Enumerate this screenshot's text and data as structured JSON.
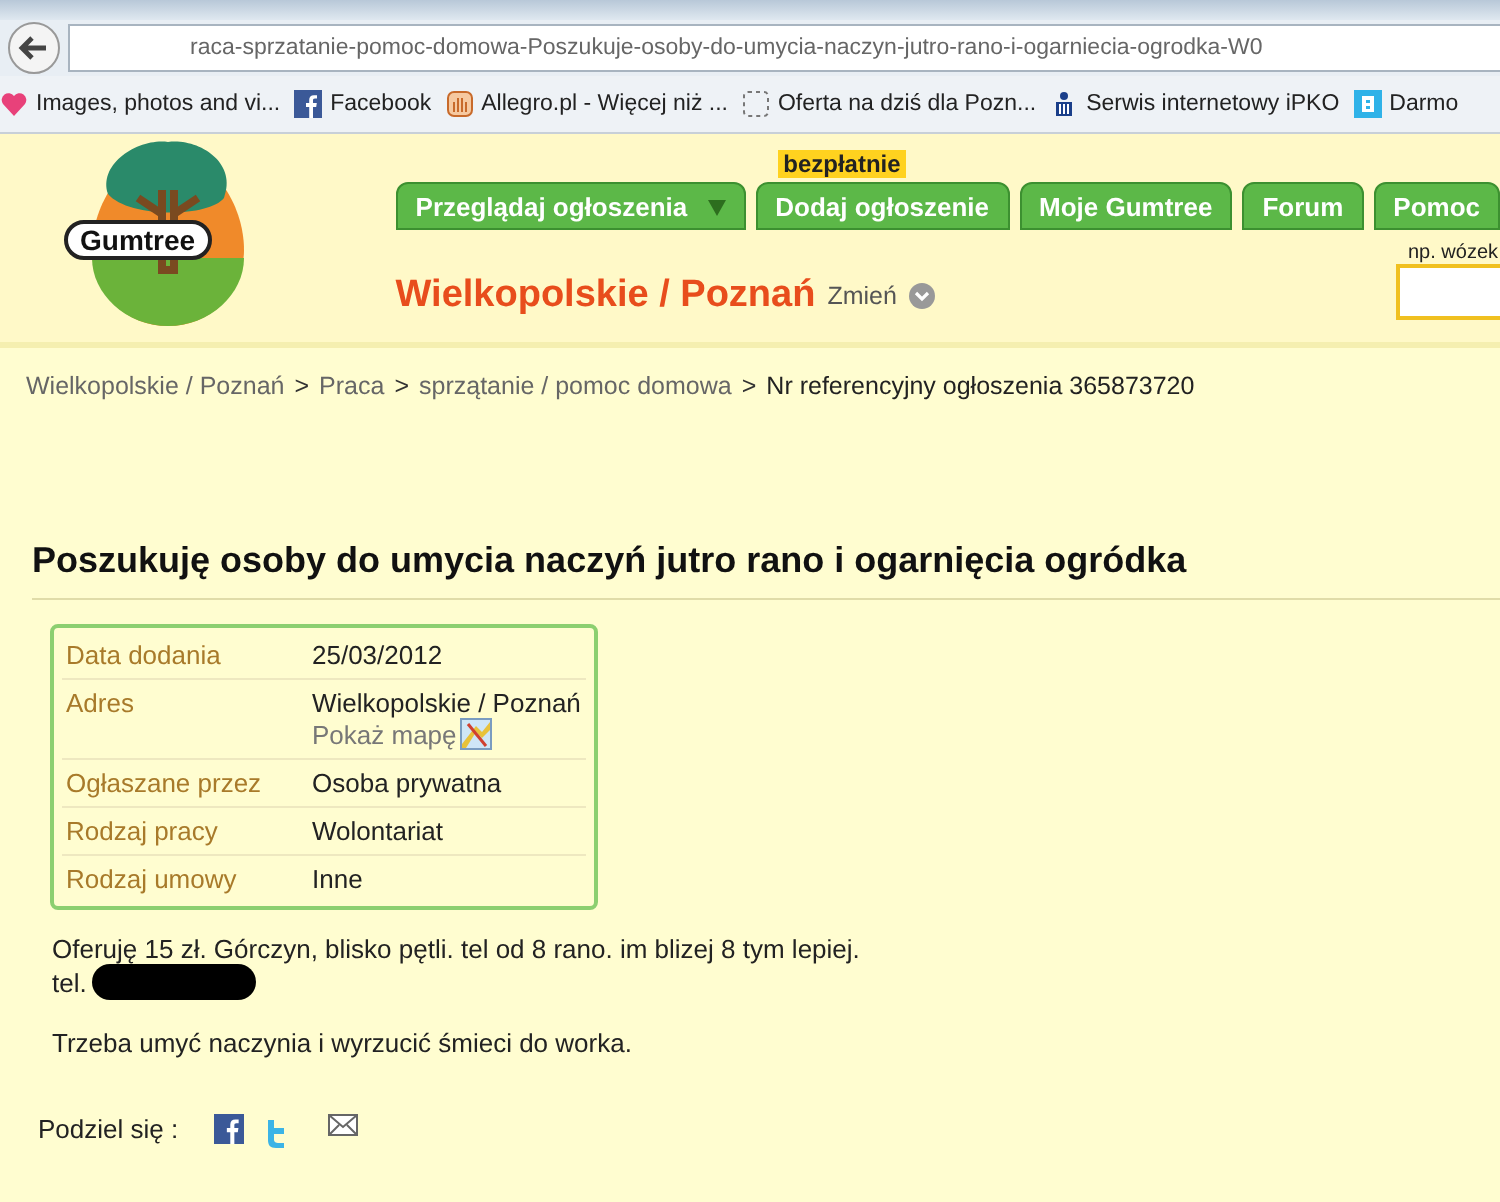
{
  "browser": {
    "url": "raca-sprzatanie-pomoc-domowa-Poszukuje-osoby-do-umycia-naczyn-jutro-rano-i-ogarniecia-ogrodka-W0",
    "bookmarks": [
      {
        "label": "Images, photos and vi..."
      },
      {
        "label": "Facebook"
      },
      {
        "label": "Allegro.pl - Więcej niż ..."
      },
      {
        "label": "Oferta na dziś dla Pozn..."
      },
      {
        "label": "Serwis internetowy iPKO"
      },
      {
        "label": "Darmo"
      }
    ]
  },
  "header": {
    "logo": "Gumtree",
    "nav_tabs": [
      {
        "label": "Przeglądaj ogłoszenia",
        "kind": "dropdown"
      },
      {
        "label": "Dodaj ogłoszenie",
        "kind": "badge",
        "badge": "bezpłatnie"
      },
      {
        "label": "Moje Gumtree",
        "kind": "plain"
      },
      {
        "label": "Forum",
        "kind": "plain"
      },
      {
        "label": "Pomoc",
        "kind": "plain"
      }
    ],
    "location": "Wielkopolskie / Poznań",
    "change_link": "Zmień",
    "search_hint": "np. wózek"
  },
  "breadcrumb": [
    {
      "label": "Wielkopolskie / Poznań",
      "kind": "link"
    },
    {
      "label": ">",
      "kind": "separator"
    },
    {
      "label": "Praca",
      "kind": "link"
    },
    {
      "label": ">",
      "kind": "separator"
    },
    {
      "label": "sprzątanie / pomoc domowa",
      "kind": "link"
    },
    {
      "label": ">",
      "kind": "separator"
    },
    {
      "label": "Nr referencyjny ogłoszenia 365873720",
      "kind": "current"
    }
  ],
  "listing": {
    "title": "Poszukuję osoby do umycia naczyń jutro rano i ogarnięcia ogródka",
    "details": [
      {
        "label": "Data dodania",
        "value": "25/03/2012"
      },
      {
        "label": "Adres",
        "value": "Wielkopolskie / Poznań",
        "link": "Pokaż mapę"
      },
      {
        "label": "Ogłaszane przez",
        "value": "Osoba prywatna"
      },
      {
        "label": "Rodzaj pracy",
        "value": "Wolontariat"
      },
      {
        "label": "Rodzaj umowy",
        "value": "Inne"
      }
    ],
    "description": "Oferuję 15 zł. Górczyn, blisko pętli. tel od 8 rano. im blizej 8 tym lepiej.",
    "phone_label": "tel.",
    "body": "Trzeba umyć naczynia i wyrzucić śmieci do worka.",
    "share_label": "Podziel się :"
  }
}
